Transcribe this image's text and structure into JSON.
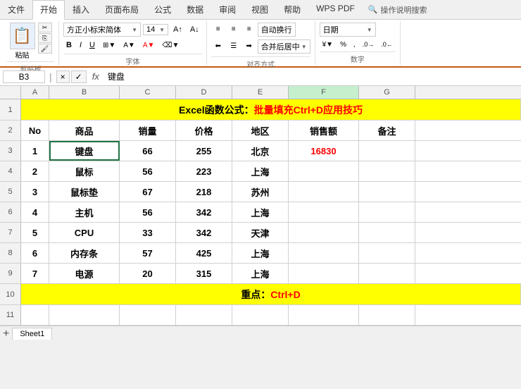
{
  "ribbon": {
    "tabs": [
      "文件",
      "开始",
      "插入",
      "页面布局",
      "公式",
      "数据",
      "审阅",
      "视图",
      "帮助",
      "WPS PDF",
      "操作说明搜索"
    ],
    "active_tab": "开始",
    "paste_label": "粘贴",
    "clipboard_label": "剪贴板",
    "font_name": "方正小标宋简体",
    "font_size": "14",
    "bold_label": "B",
    "italic_label": "I",
    "underline_label": "U",
    "font_group_label": "字体",
    "align_group_label": "对齐方式",
    "wrap_label": "自动换行",
    "merge_label": "合并后居中",
    "number_group_label": "数字",
    "number_format": "日期"
  },
  "formula_bar": {
    "cell_ref": "B3",
    "fx_symbol": "fx",
    "formula_value": "键盘",
    "cancel_btn": "×",
    "confirm_btn": "✓"
  },
  "columns": {
    "headers": [
      "A",
      "B",
      "C",
      "D",
      "E",
      "F",
      "G"
    ],
    "widths": [
      40,
      100,
      80,
      80,
      80,
      100,
      80
    ]
  },
  "rows": [
    {
      "row_num": "1",
      "cells": [
        "",
        "",
        "",
        "",
        "",
        "",
        ""
      ],
      "style": "yellow-merged",
      "merged_text": "Excel函数公式：批量填充Ctrl+D应用技巧",
      "merged_text_plain": "Excel函数公式：",
      "merged_text_highlight": "批量填充Ctrl+D应用技巧"
    },
    {
      "row_num": "2",
      "cells": [
        "No",
        "商品",
        "销量",
        "价格",
        "地区",
        "销售额",
        "备注"
      ],
      "style": "header"
    },
    {
      "row_num": "3",
      "cells": [
        "1",
        "键盘",
        "66",
        "255",
        "北京",
        "16830",
        ""
      ],
      "style": "data",
      "selected_cell": 1
    },
    {
      "row_num": "4",
      "cells": [
        "2",
        "鼠标",
        "56",
        "223",
        "上海",
        "",
        ""
      ],
      "style": "data"
    },
    {
      "row_num": "5",
      "cells": [
        "3",
        "鼠标垫",
        "67",
        "218",
        "苏州",
        "",
        ""
      ],
      "style": "data"
    },
    {
      "row_num": "6",
      "cells": [
        "4",
        "主机",
        "56",
        "342",
        "上海",
        "",
        ""
      ],
      "style": "data"
    },
    {
      "row_num": "7",
      "cells": [
        "5",
        "CPU",
        "33",
        "342",
        "天津",
        "",
        ""
      ],
      "style": "data"
    },
    {
      "row_num": "8",
      "cells": [
        "6",
        "内存条",
        "57",
        "425",
        "上海",
        "",
        ""
      ],
      "style": "data"
    },
    {
      "row_num": "9",
      "cells": [
        "7",
        "电源",
        "20",
        "315",
        "上海",
        "",
        ""
      ],
      "style": "data"
    },
    {
      "row_num": "10",
      "cells": [
        "",
        "",
        "",
        "",
        "",
        "",
        ""
      ],
      "style": "yellow-merged",
      "merged_text": "重点：Ctrl+D",
      "merged_text_plain": "重点：",
      "merged_text_highlight": "Ctrl+D"
    }
  ],
  "footer": {
    "sheet_name": "Sheet1"
  }
}
